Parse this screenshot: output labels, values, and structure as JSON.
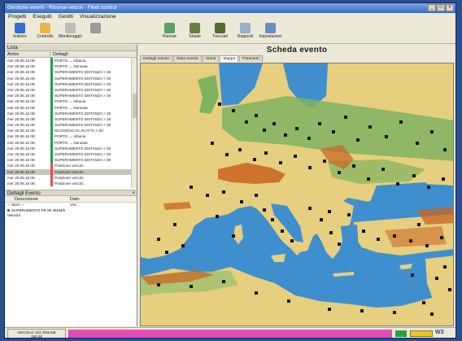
{
  "window": {
    "title": "Gestione eventi - Risorse veicoli - Fleet control",
    "btn_min": "_",
    "btn_max": "□",
    "btn_close": "×"
  },
  "menu": [
    "Progetti",
    "Eseguiti",
    "Gestiti",
    "Visualizzazione"
  ],
  "toolbar": [
    {
      "label": "Indietro",
      "icon": "back-icon",
      "color": "#2f6fd0"
    },
    {
      "label": "Controllo",
      "icon": "documents-icon",
      "color": "#e8b84a"
    },
    {
      "label": "Monitoraggio",
      "icon": "clipboard-icon",
      "color": "#bdbdbd"
    },
    {
      "label": "",
      "icon": "list-icon",
      "color": "#9a9a9a"
    },
    {
      "label": "Risorse",
      "icon": "globe-icon",
      "color": "#5aa06a"
    },
    {
      "label": "Strade",
      "icon": "truck-icon",
      "color": "#6a7f3c"
    },
    {
      "label": "Tracciati",
      "icon": "track-icon",
      "color": "#556b2f"
    },
    {
      "label": "Rapporti",
      "icon": "report-icon",
      "color": "#9ab0c8"
    },
    {
      "label": "Impostazioni",
      "icon": "settings-icon",
      "color": "#6a8ec0"
    }
  ],
  "left_panel": {
    "title": "Lista",
    "columns": [
      "Arrivo",
      "Dettagli"
    ],
    "events": [
      {
        "date": "mer 20.06.16 09:",
        "text": "PORTO → Albania",
        "color": "#2a9a45"
      },
      {
        "date": "mer 20.06.16 09:",
        "text": "PORTO → Nonnata",
        "color": "#2a9a45"
      },
      {
        "date": "mer 20.06.16 09:",
        "text": "SUPERAMENTO DISTANZA > 30",
        "color": "#2a9a45"
      },
      {
        "date": "mer 20.06.16 09:",
        "text": "SUPERAMENTO DISTANZA > 30",
        "color": "#2a9a45"
      },
      {
        "date": "mer 20.06.16 09:",
        "text": "SUPERAMENTO DISTANZA > 30",
        "color": "#2a9a45"
      },
      {
        "date": "mer 20.06.16 09:",
        "text": "SUPERAMENTO DISTANZA > 30",
        "color": "#2a9a45"
      },
      {
        "date": "mer 20.06.16 09:",
        "text": "SUPERAMENTO DISTANZA > 30",
        "color": "#2a9a45"
      },
      {
        "date": "mer 20.06.16 09:",
        "text": "PORTO → Albania",
        "color": "#2a9a45"
      },
      {
        "date": "mer 20.06.16 09:",
        "text": "PORTO → Nonnata",
        "color": "#2a9a45"
      },
      {
        "date": "mer 20.06.16 09:",
        "text": "SUPERAMENTO DISTANZA > 30",
        "color": "#2a9a45"
      },
      {
        "date": "mer 20.06.16 09:",
        "text": "SUPERAMENTO DISTANZA > 30",
        "color": "#2a9a45"
      },
      {
        "date": "mer 20.06.16 09:",
        "text": "SUPERAMENTO DISTANZA > 30",
        "color": "#2a9a45"
      },
      {
        "date": "mer 20.06.16 09:",
        "text": "RICONOSC.IO SCATTA > 50",
        "color": "#2a9a45"
      },
      {
        "date": "mer 20.06.16 09:",
        "text": "PORTO → Albania",
        "color": "#2a9a45"
      },
      {
        "date": "mer 20.06.16 09:",
        "text": "PORTO → Nonnata",
        "color": "#2a9a45"
      },
      {
        "date": "mer 20.06.16 09:",
        "text": "SUPERAMENTO DISTANZA > 30",
        "color": "#2a9a45"
      },
      {
        "date": "mer 20.06.16 09:",
        "text": "SUPERAMENTO DISTANZA > 30",
        "color": "#2a9a45"
      },
      {
        "date": "mer 20.06.16 09:",
        "text": "SUPERAMENTO DISTANZA > 30",
        "color": "#2a9a45"
      },
      {
        "date": "mer 20.06.16 09:",
        "text": "Posizione veicolo",
        "color": "#e05050"
      },
      {
        "date": "mer 20.06.16 09:",
        "text": "Posizione veicolo",
        "color": "#e05050"
      },
      {
        "date": "mer 20.06.16 09:",
        "text": "Posizione veicolo",
        "color": "#e05050"
      },
      {
        "date": "mer 20.06.16 09:",
        "text": "Posizione veicolo",
        "color": "#e05050"
      }
    ]
  },
  "detail_panel": {
    "title": "Dettagli Evento",
    "close": "×",
    "columns": [
      "Descrizione",
      "Dato"
    ],
    "rows": [
      {
        "label": "— BUS —",
        "value": "VAL"
      },
      {
        "label": "SUPERAMENTO PE 00 45KM/h",
        "value": ""
      },
      {
        "label": "Velocità",
        "value": ""
      }
    ]
  },
  "right_panel": {
    "title": "Scheda evento",
    "tabs": [
      "Dettagli evento",
      "Stato evento",
      "Storia",
      "Mappa",
      "Parametri"
    ],
    "active_tab": "Mappa"
  },
  "map": {
    "sea_color": "#3f8fcf",
    "land_color": "#e6cf7e",
    "green_color": "#7fb360",
    "mountain_color": "#c7641e",
    "marker_color": "#151515"
  },
  "status": {
    "cell1_line1": "VEICOLO 124 ONLINE",
    "cell1_line2": "150.00",
    "brand": "W3"
  }
}
